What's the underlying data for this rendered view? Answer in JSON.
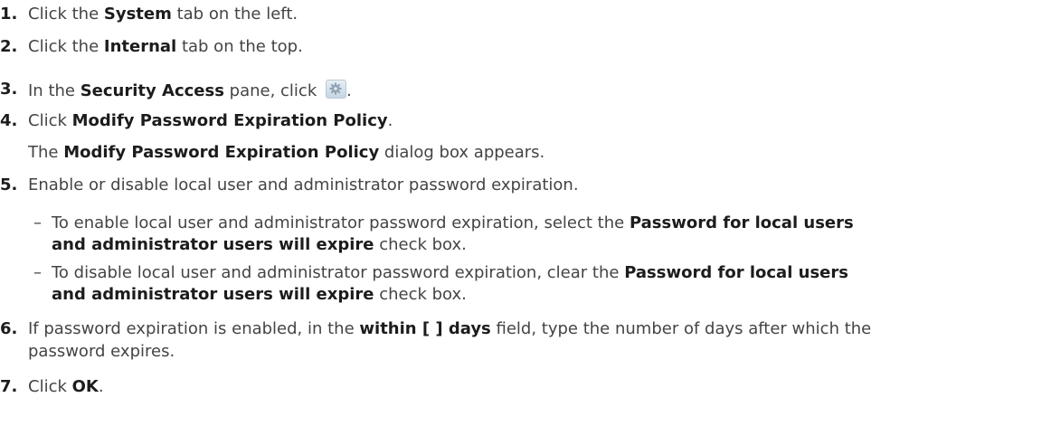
{
  "steps": [
    {
      "num": "1.",
      "parts": [
        "Click the ",
        "System",
        " tab on the left."
      ]
    },
    {
      "num": "2.",
      "parts": [
        "Click the ",
        "Internal",
        " tab on the top."
      ]
    },
    {
      "num": "3.",
      "parts": [
        "In the ",
        "Security Access",
        " pane, click ",
        "."
      ],
      "icon": "gear-icon"
    },
    {
      "num": "4.",
      "parts": [
        "Click ",
        "Modify Password Expiration Policy",
        "."
      ],
      "note": [
        "The ",
        "Modify Password Expiration Policy",
        " dialog box appears."
      ]
    },
    {
      "num": "5.",
      "text": "Enable or disable local user and administrator password expiration."
    },
    {
      "num": "6.",
      "parts": [
        "If password expiration is enabled, in the ",
        "within [ ] days",
        " field, type the number of days after which the"
      ],
      "line2": "password expires."
    },
    {
      "num": "7.",
      "parts": [
        "Click ",
        "OK",
        "."
      ]
    }
  ],
  "substeps": [
    {
      "dash": "–",
      "line1": [
        "To enable local user and administrator password expiration, select the ",
        "Password for local users"
      ],
      "line2": [
        "and administrator users will expire",
        " check box."
      ]
    },
    {
      "dash": "–",
      "line1": [
        "To disable local user and administrator password expiration, clear the ",
        "Password for local users"
      ],
      "line2": [
        "and administrator users will expire",
        " check box."
      ]
    }
  ]
}
